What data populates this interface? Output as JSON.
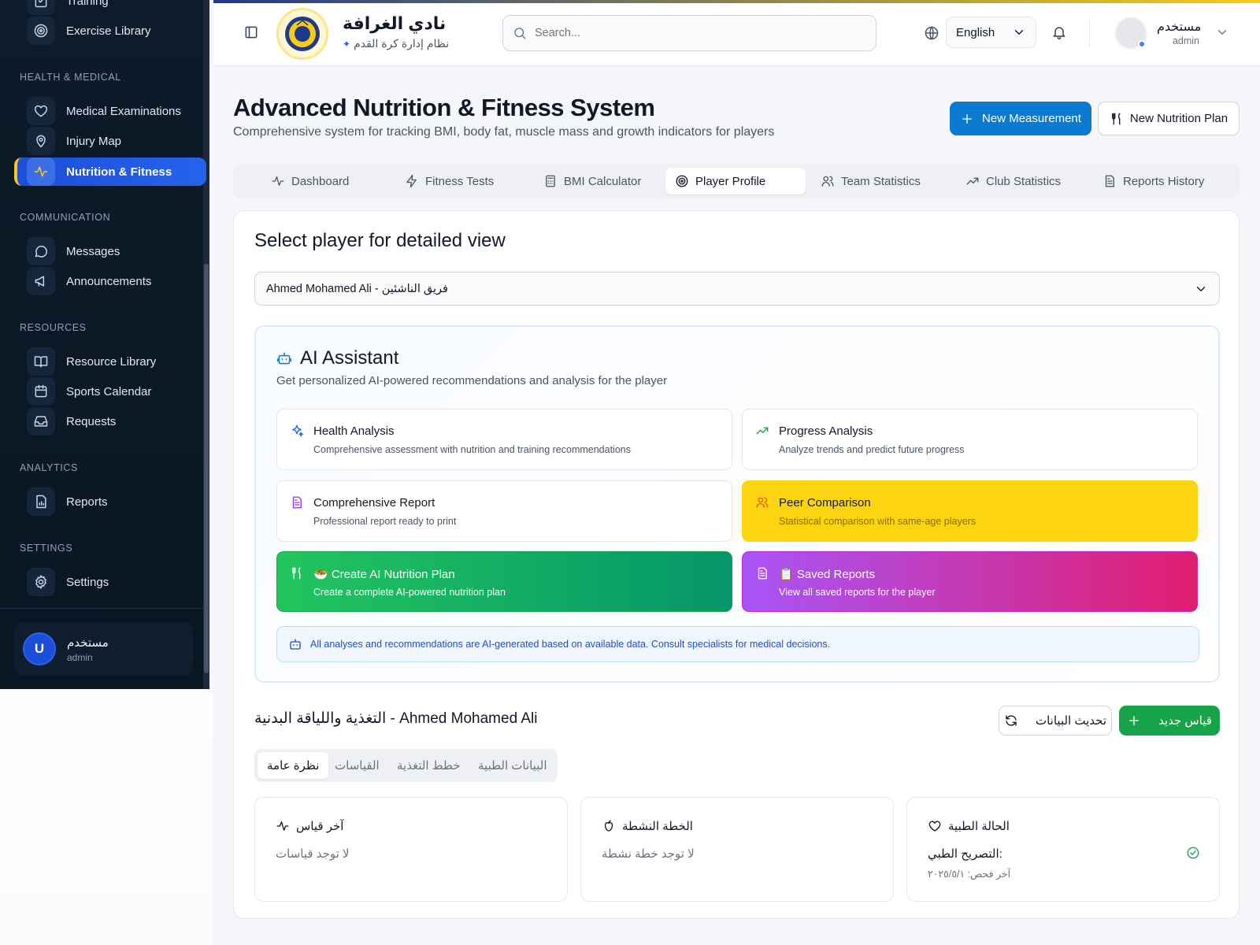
{
  "sidebar": {
    "cut_item": "Training",
    "exercise_library": "Exercise Library",
    "sections": {
      "health": "HEALTH & MEDICAL",
      "communication": "COMMUNICATION",
      "resources": "RESOURCES",
      "analytics": "ANALYTICS",
      "settings": "SETTINGS"
    },
    "items": {
      "medical": "Medical Examinations",
      "injury": "Injury Map",
      "nutrition": "Nutrition & Fitness",
      "messages": "Messages",
      "announcements": "Announcements",
      "resource_library": "Resource Library",
      "calendar": "Sports Calendar",
      "requests": "Requests",
      "reports": "Reports",
      "settings": "Settings"
    },
    "user": {
      "initial": "U",
      "name": "مستخدم",
      "role": "admin"
    }
  },
  "header": {
    "club_name": "نادي الغرافة",
    "club_sub": "نظام إدارة كرة القدم",
    "search_placeholder": "Search...",
    "language": "English",
    "user_name": "مستخدم",
    "user_role": "admin"
  },
  "page": {
    "title": "Advanced Nutrition & Fitness System",
    "subtitle": "Comprehensive system for tracking BMI, body fat, muscle mass and growth indicators for players",
    "new_measurement": "New Measurement",
    "new_nutrition_plan": "New Nutrition Plan",
    "tabs": [
      "Dashboard",
      "Fitness Tests",
      "BMI Calculator",
      "Player Profile",
      "Team Statistics",
      "Club Statistics",
      "Reports History"
    ]
  },
  "profile": {
    "select_title": "Select player for detailed view",
    "selected_player": "Ahmed Mohamed Ali - فريق الناشئين"
  },
  "ai": {
    "title": "AI Assistant",
    "subtitle": "Get personalized AI-powered recommendations and analysis for the player",
    "tiles": [
      {
        "title": "Health Analysis",
        "desc": "Comprehensive assessment with nutrition and training recommendations"
      },
      {
        "title": "Progress Analysis",
        "desc": "Analyze trends and predict future progress"
      },
      {
        "title": "Comprehensive Report",
        "desc": "Professional report ready to print"
      },
      {
        "title": "Peer Comparison",
        "desc": "Statistical comparison with same-age players"
      },
      {
        "title": "🥗 Create AI Nutrition Plan",
        "desc": "Create a complete AI-powered nutrition plan"
      },
      {
        "title": "📋 Saved Reports",
        "desc": "View all saved reports for the player"
      }
    ],
    "notice": "All analyses and recommendations are AI-generated based on available data. Consult specialists for medical decisions."
  },
  "nutrition": {
    "title": "التغذية واللياقة البدنية - Ahmed Mohamed Ali",
    "refresh": "تحديث البيانات",
    "new": "قياس جديد",
    "subtabs": [
      "نظرة عامة",
      "القياسات",
      "خطط التغذية",
      "البيانات الطبية"
    ],
    "cards": {
      "last_measure": {
        "title": "آخر قياس",
        "text": "لا توجد قياسات"
      },
      "active_plan": {
        "title": "الخطة النشطة",
        "text": "لا توجد خطة نشطة"
      },
      "medical": {
        "title": "الحالة الطبية",
        "text": "التصريح الطبي:",
        "date": "آخر فحص: ٢٠٢٥/٥/١"
      }
    }
  },
  "colors": {
    "sidebar_bg": "#0d1b2a",
    "active_item": "#2563eb",
    "primary_button": "#0a7bd0",
    "green": "#16a34a",
    "yellow_tile": "#fcd410",
    "magenta_tile": "#e11d6f"
  }
}
